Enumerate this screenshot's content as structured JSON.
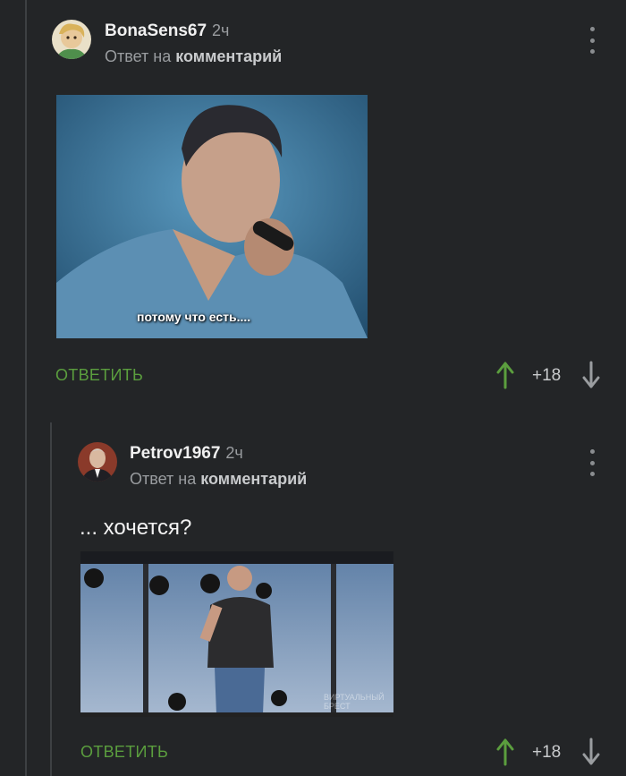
{
  "comments": [
    {
      "username": "BonaSens67",
      "time": "2ч",
      "reply_prefix": "Ответ на",
      "reply_target": "комментарий",
      "image_caption": "потому что есть....",
      "reply_label": "ОТВЕТИТЬ",
      "score": "+18"
    },
    {
      "username": "Petrov1967",
      "time": "2ч",
      "reply_prefix": "Ответ на",
      "reply_target": "комментарий",
      "text": "... хочется?",
      "watermark": "ВИРТУАЛЬНЫЙ БРЕСТ",
      "reply_label": "ОТВЕТИТЬ",
      "score": "+18"
    }
  ],
  "colors": {
    "background": "#232527",
    "accent_green": "#5b9e3e",
    "muted_text": "#9a9da0"
  },
  "icons": [
    "more-icon",
    "upvote-arrow-icon",
    "downvote-arrow-icon"
  ]
}
